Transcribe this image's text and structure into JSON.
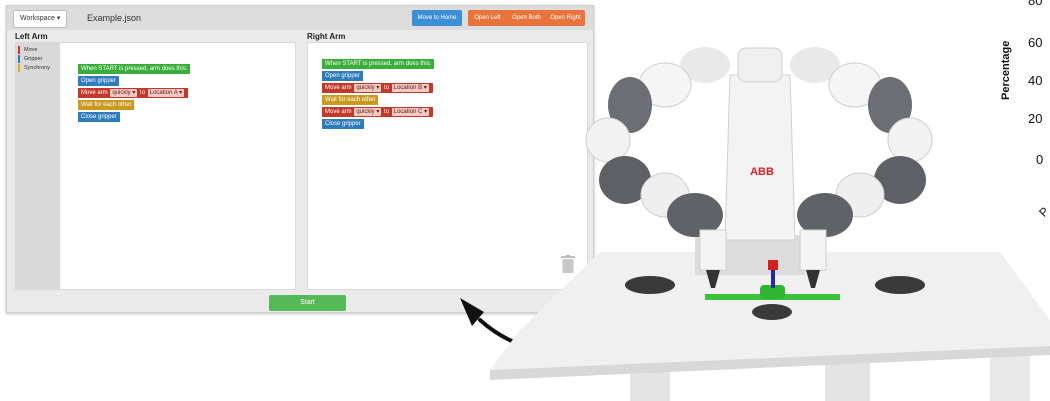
{
  "topbar": {
    "workspace_label": "Workspace ▾",
    "filename": "Example.json",
    "move_home": "Move to Home",
    "open_left": "Open Left",
    "open_both": "Open Both",
    "open_right": "Open Right"
  },
  "left": {
    "title": "Left Arm",
    "toolbox": [
      {
        "label": "Move",
        "color": "#d9342b"
      },
      {
        "label": "Gripper",
        "color": "#2f7cbd"
      },
      {
        "label": "Synchrony",
        "color": "#e0b21c"
      }
    ],
    "blocks": {
      "when": "When START is pressed, arm does this:",
      "open_gripper": "Open gripper",
      "move_prefix": "Move arm",
      "speed": "quickly ▾",
      "to": "to",
      "location_a": "Location A ▾",
      "wait": "Wait for each other",
      "close_gripper": "Close gripper"
    }
  },
  "right": {
    "title": "Right Arm",
    "blocks": {
      "when": "When START is pressed, arm does this:",
      "open_gripper": "Open gripper",
      "move_prefix": "Move arm",
      "speed": "quickly ▾",
      "to": "to",
      "location_b": "Location B ▾",
      "wait": "Wait for each other",
      "speed2": "quickly ▾",
      "location_c": "Location C ▾",
      "close_gripper": "Close gripper"
    }
  },
  "footer": {
    "start": "Start"
  },
  "robot": {
    "logo": "ABB"
  },
  "chart_fragment": {
    "ylabel": "Percentage",
    "ticks": [
      "80",
      "60",
      "40",
      "20",
      "0"
    ],
    "partial_label": "P"
  }
}
